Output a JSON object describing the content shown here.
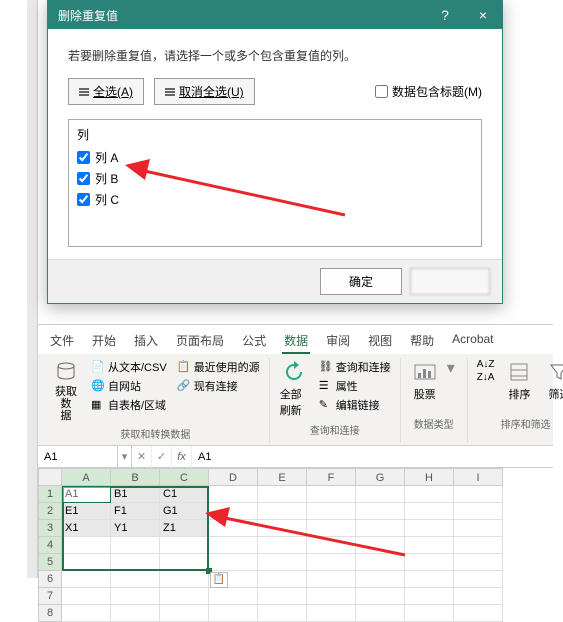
{
  "dialog": {
    "title": "删除重复值",
    "help": "?",
    "close": "×",
    "instruction": "若要删除重复值，请选择一个或多个包含重复值的列。",
    "select_all": "全选(A)",
    "deselect_all": "取消全选(U)",
    "header_checkbox": "数据包含标题(M)",
    "list_header": "列",
    "columns": [
      {
        "label": "列 A",
        "checked": true
      },
      {
        "label": "列 B",
        "checked": true
      },
      {
        "label": "列 C",
        "checked": true
      }
    ],
    "ok": "确定",
    "cancel": ""
  },
  "tabs": {
    "items": [
      "文件",
      "开始",
      "插入",
      "页面布局",
      "公式",
      "数据",
      "审阅",
      "视图",
      "帮助",
      "Acrobat"
    ],
    "active": "数据"
  },
  "ribbon": {
    "group1": {
      "main": "获取数\n据",
      "items": [
        "从文本/CSV",
        "自网站",
        "自表格/区域",
        "最近使用的源",
        "现有连接"
      ],
      "label": "获取和转换数据"
    },
    "group2": {
      "main": "全部刷新",
      "items": [
        "查询和连接",
        "属性",
        "编辑链接"
      ],
      "label": "查询和连接"
    },
    "group3": {
      "main": "股票",
      "label": "数据类型"
    },
    "group4": {
      "sort": "排序",
      "filter": "筛选",
      "label": "排序和筛选"
    }
  },
  "namebox": "A1",
  "formula": "A1",
  "sheet": {
    "cols": [
      "A",
      "B",
      "C",
      "D",
      "E",
      "F",
      "G",
      "H",
      "I"
    ],
    "rows": [
      [
        "A1",
        "B1",
        "C1",
        "",
        "",
        "",
        "",
        "",
        ""
      ],
      [
        "E1",
        "F1",
        "G1",
        "",
        "",
        "",
        "",
        "",
        ""
      ],
      [
        "X1",
        "Y1",
        "Z1",
        "",
        "",
        "",
        "",
        "",
        ""
      ],
      [
        "",
        "",
        "",
        "",
        "",
        "",
        "",
        "",
        ""
      ],
      [
        "",
        "",
        "",
        "",
        "",
        "",
        "",
        "",
        ""
      ],
      [
        "",
        "",
        "",
        "",
        "",
        "",
        "",
        "",
        ""
      ],
      [
        "",
        "",
        "",
        "",
        "",
        "",
        "",
        "",
        ""
      ],
      [
        "",
        "",
        "",
        "",
        "",
        "",
        "",
        "",
        ""
      ]
    ]
  }
}
